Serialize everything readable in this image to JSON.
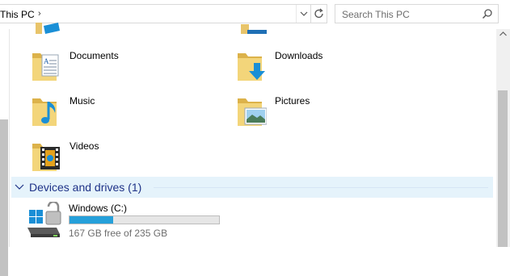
{
  "address": {
    "path": "This PC",
    "separator": "›"
  },
  "search": {
    "placeholder": "Search This PC"
  },
  "folders": [
    {
      "label": "Documents",
      "icon": "documents-folder-icon"
    },
    {
      "label": "Downloads",
      "icon": "downloads-folder-icon"
    },
    {
      "label": "Music",
      "icon": "music-folder-icon"
    },
    {
      "label": "Pictures",
      "icon": "pictures-folder-icon"
    },
    {
      "label": "Videos",
      "icon": "videos-folder-icon"
    }
  ],
  "devices": {
    "header": "Devices and drives (1)",
    "drives": [
      {
        "name": "Windows (C:)",
        "free_text": "167 GB free of 235 GB",
        "used_fraction": 0.29
      }
    ]
  },
  "colors": {
    "accent": "#26a0da",
    "group_header": "#1e3287",
    "group_bg": "#e5f3fb"
  }
}
